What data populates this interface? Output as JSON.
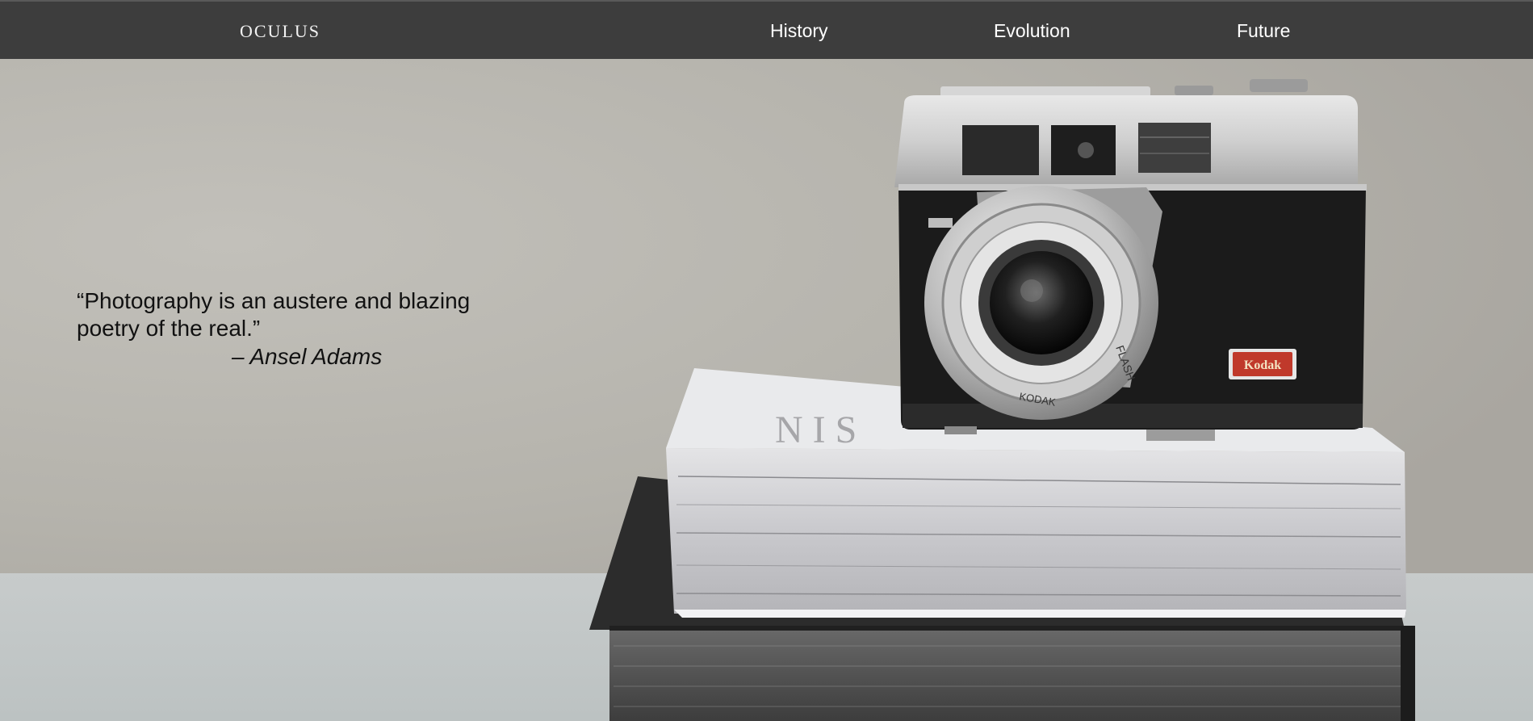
{
  "nav": {
    "brand": "OCULUS",
    "links": [
      {
        "label": "History"
      },
      {
        "label": "Evolution"
      },
      {
        "label": "Future"
      }
    ]
  },
  "hero": {
    "quote": "“Photography is an austere and blazing poetry of the real.”",
    "author": "– Ansel Adams",
    "camera_badge": "Kodak",
    "lens_ring_text": "FLASH",
    "lens_brand_text": "KODAK"
  },
  "colors": {
    "navbar": "#3d3d3d",
    "wall": "#b7b5ae",
    "table": "#c3c7c6",
    "badge_red": "#c0392b"
  }
}
